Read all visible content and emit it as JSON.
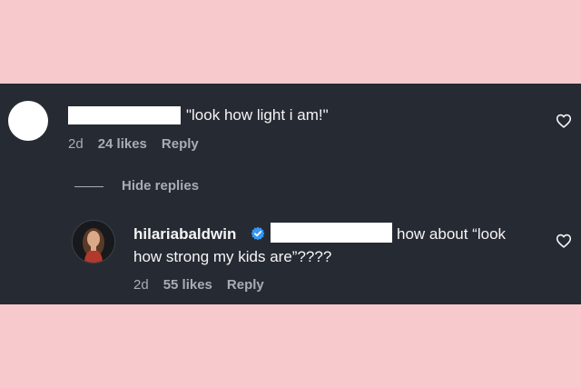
{
  "comment1": {
    "text": "\"look how light i am!\"",
    "time": "2d",
    "likes": "24 likes",
    "reply": "Reply"
  },
  "hide_replies": "Hide replies",
  "comment2": {
    "username": "hilariabaldwin",
    "text_line1": "how about “look",
    "text_line2": "how strong my kids are”????",
    "time": "2d",
    "likes": "55 likes",
    "reply": "Reply"
  },
  "colors": {
    "background": "#f8c9cc",
    "panel": "#262a33",
    "text": "#f5f5f5",
    "meta": "#a8acb4",
    "verified": "#3897f0"
  },
  "icons": {
    "like": "heart-outline-icon",
    "verified": "verified-badge-icon"
  }
}
